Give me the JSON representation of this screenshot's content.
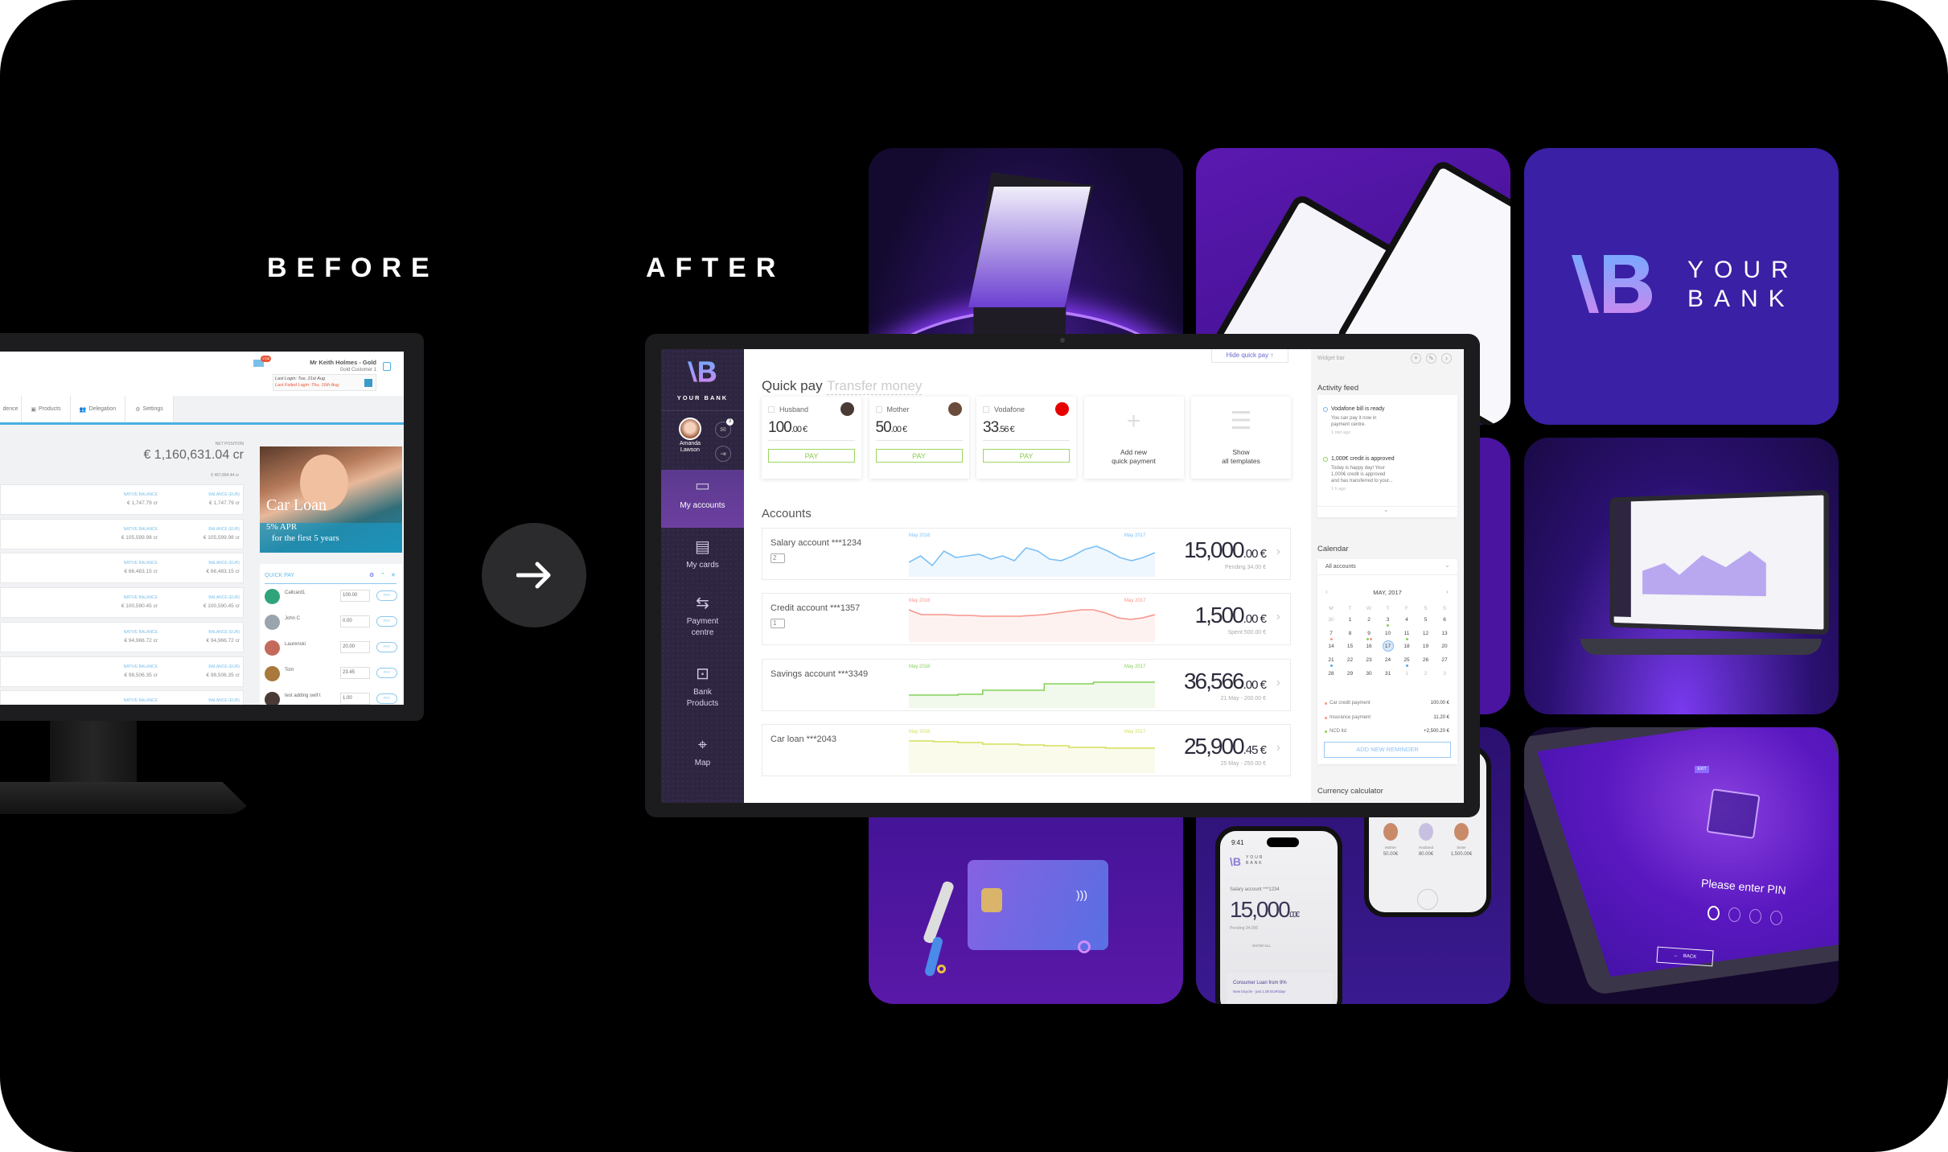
{
  "headings": {
    "before": "BEFORE",
    "after": "AFTER"
  },
  "colors": {
    "brand_purple": "#3b1fa6",
    "sidebar": "#2e2641",
    "accent_green": "#9bd760",
    "salary_blue": "#7cc0f5",
    "credit_red": "#f7958a",
    "savings_green": "#86d05a",
    "loan_yellow": "#d4e05a",
    "old_blue": "#4ab0e0"
  },
  "before": {
    "header": {
      "customer_name": "Mr Keith Holmes - Gold",
      "customer_tier": "Gold Customer 1",
      "last_login": "Last Login: Tue, 21st Aug",
      "last_failed_login": "Last Failed Login: Thu, 16th Aug",
      "mail_badge": "1736"
    },
    "nav": [
      {
        "label": "dence",
        "icon": ""
      },
      {
        "label": "Products",
        "icon": "briefcase-icon"
      },
      {
        "label": "Delegation",
        "icon": "users-icon"
      },
      {
        "label": "Settings",
        "icon": "gear-icon"
      }
    ],
    "net_position_label": "NET POSITION",
    "net_position": "€ 1,160,631.04 cr",
    "sub_total": "€ 467,894.44 cr",
    "native_label": "NATIVE BALANCE",
    "eur_label": "BALANCE (EUR)",
    "rows": [
      {
        "native": "€ 1,747.79 cr",
        "eur": "€ 1,747.79 cr"
      },
      {
        "native": "€ 105,599.98 cr",
        "eur": "€ 105,599.98 cr"
      },
      {
        "native": "€ 66,483.15 cr",
        "eur": "€ 66,483.15 cr"
      },
      {
        "native": "€ 100,590.45 cr",
        "eur": "€ 100,590.45 cr"
      },
      {
        "native": "€ 94,966.72 cr",
        "eur": "€ 94,966.72 cr"
      },
      {
        "native": "€ 98,506.35 cr",
        "eur": "€ 98,506.35 cr"
      },
      {
        "native": "",
        "eur": ""
      }
    ],
    "ad": {
      "title": "Car Loan",
      "line1": "5% APR",
      "line2": "for the first 5 years"
    },
    "quick_pay": {
      "title": "QUICK PAY",
      "pay_label": "PAY",
      "items": [
        {
          "name": "Callcard1",
          "amount": "100.00",
          "color": "#2fa37a"
        },
        {
          "name": "John C",
          "amount": "0.00",
          "color": "#9aa4ad"
        },
        {
          "name": "Laurenski",
          "amount": "20.00",
          "color": "#c46a5a"
        },
        {
          "name": "Tom",
          "amount": "23.45",
          "color": "#a8793a"
        },
        {
          "name": "test adding swif t",
          "amount": "1.00",
          "color": "#4a3a35"
        }
      ]
    }
  },
  "after": {
    "sidebar": {
      "brand": "YOUR BANK",
      "user_first": "Amanda",
      "user_last": "Lawson",
      "mail_badge": "3",
      "items": [
        {
          "label": "My accounts",
          "icon": "wallet-icon",
          "active": true
        },
        {
          "label": "My cards",
          "icon": "card-icon",
          "active": false
        },
        {
          "label": "Payment centre",
          "icon": "transfer-icon",
          "active": false
        },
        {
          "label": "Bank Products",
          "icon": "briefcase-icon",
          "active": false
        },
        {
          "label": "Map",
          "icon": "map-pin-icon",
          "active": false
        }
      ]
    },
    "main": {
      "tabs": [
        {
          "label": "Quick pay",
          "active": true
        },
        {
          "label": "Transfer money",
          "active": false
        }
      ],
      "hide_quick_pay": "Hide quick pay ↑",
      "quick_pay": [
        {
          "name": "Husband",
          "amount_main": "100",
          "amount_dec": ".00 €",
          "avatar_color": "#4a3a35"
        },
        {
          "name": "Mother",
          "amount_main": "50",
          "amount_dec": ".00 €",
          "avatar_color": "#6a4a3a"
        },
        {
          "name": "Vodafone",
          "amount_main": "33",
          "amount_dec": ".56 €",
          "avatar_color": "#e60000"
        }
      ],
      "pay_label": "PAY",
      "add_new": [
        "Add new",
        "quick payment"
      ],
      "show_all": [
        "Show",
        "all templates"
      ],
      "accounts_title": "Accounts",
      "accounts": [
        {
          "name": "Salary account ***1234",
          "badge": "2",
          "from": "May 2016",
          "to": "May 2017",
          "bal_main": "15,000",
          "bal_dec": ".00 €",
          "sub": "Pending 34.00 €",
          "color": "#7cc0f5"
        },
        {
          "name": "Credit account ***1357",
          "badge": "1",
          "from": "May 2016",
          "to": "May 2017",
          "bal_main": "1,500",
          "bal_dec": ".00 €",
          "sub": "Spent 500.00 €",
          "color": "#f7958a"
        },
        {
          "name": "Savings account ***3349",
          "badge": "",
          "from": "May 2016",
          "to": "May 2017",
          "bal_main": "36,566",
          "bal_dec": ".00 €",
          "sub": "21 May - 200.00 €",
          "color": "#86d05a"
        },
        {
          "name": "Car loan ***2043",
          "badge": "",
          "from": "May 2016",
          "to": "May 2017",
          "bal_main": "25,900",
          "bal_dec": ".45 €",
          "sub": "25 May - 250.00 €",
          "color": "#d4e05a"
        }
      ]
    },
    "widget_bar": {
      "title": "Widget bar",
      "activity_title": "Activity feed",
      "feed": [
        {
          "title": "Vodafone bill is ready",
          "body": [
            "You can pay it now in",
            "payment centre."
          ],
          "time": "1 min ago",
          "color": "#7cb0f5"
        },
        {
          "title": "1,000€ credit is approved",
          "body": [
            "Today is happy day! Your",
            "1,000€ credit is approved",
            "and has transferred to your..."
          ],
          "time": "1 h ago",
          "color": "#86d05a"
        }
      ],
      "calendar_title": "Calendar",
      "account_select": "All accounts",
      "month": "MAY, 2017",
      "weekdays": [
        "M",
        "T",
        "W",
        "T",
        "F",
        "S",
        "S"
      ],
      "weeks": [
        [
          30,
          1,
          2,
          3,
          4,
          5,
          6
        ],
        [
          7,
          8,
          9,
          10,
          11,
          12,
          13
        ],
        [
          14,
          15,
          16,
          17,
          18,
          19,
          20
        ],
        [
          21,
          22,
          23,
          24,
          25,
          26,
          27
        ],
        [
          28,
          29,
          30,
          31,
          1,
          2,
          3
        ]
      ],
      "selected_day": 17,
      "markers": {
        "3": [
          "#86d05a"
        ],
        "7": [
          "#f7958a"
        ],
        "9": [
          "#86d05a",
          "#f7958a"
        ],
        "11": [
          "#86d05a"
        ],
        "21": [
          "#5aa8e8"
        ],
        "25": [
          "#5aa8e8"
        ]
      },
      "events": [
        {
          "label": "Car credit payment",
          "amount": "100.00 €",
          "color": "#f7958a"
        },
        {
          "label": "Insurance payment",
          "amount": "11.20 €",
          "color": "#f7958a"
        },
        {
          "label": "NCD ltd",
          "amount": "+2,500.20 €",
          "color": "#86d05a"
        }
      ],
      "add_reminder": "ADD NEW REMINDER",
      "currency_title": "Currency calculator"
    }
  },
  "tiles": {
    "logo": {
      "line1": "YOUR",
      "line2": "BANK"
    },
    "phone": {
      "time": "9:41",
      "brand1": "YOUR",
      "brand2": "BANK",
      "account": "Salary account ***1234",
      "balance_main": "15,000",
      "balance_dec": ".00€",
      "pending": "Pending 34.00€",
      "show_all": "SHOW ALL",
      "promo_title": "Consumer Loan from 9%",
      "promo_body": "New bicycle - just 1.05 EUR/day!"
    },
    "phone2": {
      "contacts": [
        {
          "name": "Mother",
          "amount": "50.00€"
        },
        {
          "name": "Husband",
          "amount": "80.00€"
        },
        {
          "name": "Sister",
          "amount": "1,500.00€"
        }
      ]
    },
    "pin": {
      "prompt": "Please enter PIN",
      "back": "BACK",
      "exit": "EXIT"
    }
  }
}
